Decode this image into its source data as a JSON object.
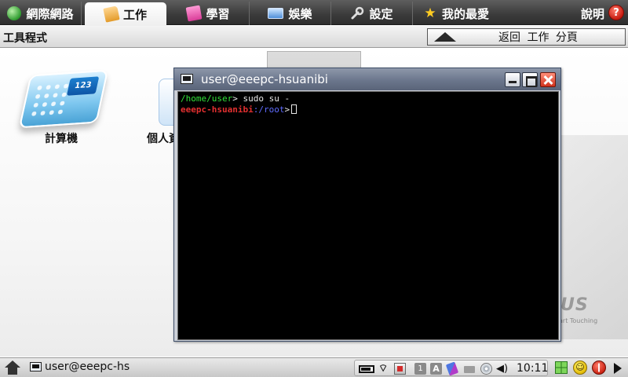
{
  "topbar": {
    "tabs": [
      {
        "label": "網際網路",
        "icon": "globe-icon"
      },
      {
        "label": "工作",
        "icon": "folder-icon",
        "active": true
      },
      {
        "label": "學習",
        "icon": "book-icon"
      },
      {
        "label": "娛樂",
        "icon": "media-icon"
      },
      {
        "label": "設定",
        "icon": "wrench-icon"
      },
      {
        "label": "我的最愛",
        "icon": "star-icon"
      }
    ],
    "help_label": "說明",
    "help_button": "?"
  },
  "category_bar": {
    "title": "工具程式",
    "back_button": "返回 工作 分頁"
  },
  "apps": [
    {
      "label": "計算機",
      "icon": "calculator-icon",
      "screen_text": "123"
    },
    {
      "label": "個人資",
      "icon": "personal-info-icon"
    }
  ],
  "background": {
    "logo_text": "US",
    "tagline": "art Touching"
  },
  "terminal": {
    "title": "user@eeepc-hsuanibi",
    "lines": [
      {
        "prompt": "/home/user",
        "suffix": "> ",
        "command": "sudo su -"
      },
      {
        "host": "eeepc-hsuanibi",
        "path": ":/root",
        "suffix": ">"
      }
    ]
  },
  "taskbar": {
    "window_item": "user@eeepc-hs",
    "tray": {
      "key1": "1",
      "keyA": "A",
      "clock": "10:11"
    }
  },
  "colors": {
    "prompt_green": "#31e23a",
    "host_red": "#e33030",
    "path_blue": "#5f6cff",
    "titlebar": "#6b768c"
  }
}
